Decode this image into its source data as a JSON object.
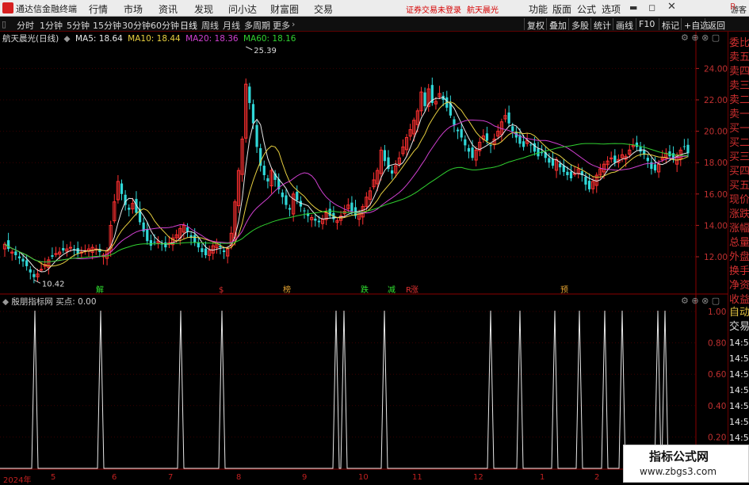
{
  "titlebar": {
    "app_name": "通达信金融终端",
    "menu": [
      "行情",
      "市场",
      "资讯",
      "发现",
      "问小达",
      "财富圈",
      "交易"
    ],
    "login_status": "证券交易未登录",
    "stock_name": "航天晨光",
    "right_menu": [
      "功能",
      "版面",
      "公式",
      "选项"
    ],
    "guest": "游客"
  },
  "toolbar": {
    "periods": [
      "分时",
      "1分钟",
      "5分钟",
      "15分钟",
      "30分钟",
      "60分钟",
      "日线",
      "周线",
      "月线",
      "多周期",
      "更多"
    ],
    "active_period": "日线",
    "right_buttons": [
      "复权",
      "叠加",
      "多股",
      "统计",
      "画线",
      "F10",
      "标记",
      "+自选",
      "返回"
    ]
  },
  "legend": {
    "title": "航天晨光(日线)",
    "ma5": "MA5: 18.64",
    "ma10": "MA10: 18.44",
    "ma20": "MA20: 18.36",
    "ma60": "MA60: 18.16",
    "colors": {
      "ma5": "#e8e8e8",
      "ma10": "#e8d040",
      "ma20": "#d040d0",
      "ma60": "#30d030"
    }
  },
  "annotations": {
    "high": "25.39",
    "low": "10.42",
    "events": [
      {
        "label": "解",
        "color": "#30e030"
      },
      {
        "label": "$",
        "color": "#e03030"
      },
      {
        "label": "榜",
        "color": "#e0a030"
      },
      {
        "label": "跌",
        "color": "#30e030"
      },
      {
        "label": "减",
        "color": "#30e030"
      },
      {
        "label": "R",
        "color": "#e03030"
      },
      {
        "label": "涨",
        "color": "#e03030"
      },
      {
        "label": "预",
        "color": "#e0a030"
      }
    ]
  },
  "indicator": {
    "name": "殷朋指标网",
    "signal": "买点: 0.00",
    "yticks": [
      "1.00",
      "0.80",
      "0.60",
      "0.40",
      "0.20"
    ]
  },
  "chart_data": {
    "type": "candlestick",
    "yticks": [
      "24.00",
      "22.00",
      "20.00",
      "18.00",
      "16.00",
      "14.00",
      "12.00"
    ],
    "ylim": [
      10.4,
      25.4
    ],
    "x_labels": [
      "2024年",
      "5",
      "6",
      "7",
      "8",
      "9",
      "10",
      "11",
      "12",
      "1",
      "2"
    ],
    "close": [
      12.8,
      12.5,
      12.3,
      12.1,
      11.9,
      11.7,
      11.4,
      11.0,
      10.7,
      10.9,
      11.2,
      11.5,
      11.8,
      12.0,
      12.2,
      12.3,
      12.4,
      12.5,
      12.6,
      12.4,
      12.2,
      12.3,
      12.4,
      12.5,
      12.6,
      12.5,
      12.3,
      12.1,
      12.4,
      14.0,
      15.5,
      16.8,
      16.0,
      15.3,
      15.0,
      15.4,
      14.8,
      14.2,
      13.6,
      13.0,
      12.7,
      12.9,
      13.0,
      12.8,
      12.6,
      12.9,
      13.2,
      13.4,
      13.8,
      14.0,
      13.6,
      13.2,
      12.9,
      12.6,
      12.3,
      12.1,
      12.4,
      12.7,
      12.9,
      12.6,
      12.3,
      12.5,
      13.5,
      15.5,
      17.5,
      19.5,
      23.0,
      21.8,
      20.5,
      19.0,
      17.8,
      17.2,
      16.8,
      17.5,
      16.9,
      16.3,
      15.8,
      15.3,
      15.0,
      16.0,
      15.6,
      15.2,
      14.9,
      14.6,
      14.5,
      14.3,
      14.2,
      14.4,
      14.8,
      14.6,
      14.4,
      14.3,
      14.6,
      14.9,
      15.3,
      14.9,
      14.6,
      14.8,
      15.2,
      15.8,
      16.2,
      16.9,
      17.5,
      18.8,
      18.1,
      17.6,
      17.3,
      17.8,
      18.3,
      19.0,
      19.6,
      20.1,
      20.7,
      21.3,
      22.5,
      21.6,
      22.7,
      21.8,
      21.9,
      22.4,
      22.0,
      21.5,
      21.0,
      20.4,
      20.0,
      19.6,
      19.1,
      18.7,
      18.3,
      18.8,
      19.3,
      19.7,
      19.4,
      19.1,
      19.5,
      20.0,
      20.6,
      21.0,
      20.5,
      20.0,
      19.6,
      19.2,
      19.0,
      19.4,
      19.1,
      18.7,
      18.4,
      18.6,
      18.3,
      18.0,
      17.8,
      18.2,
      17.7,
      17.4,
      17.2,
      17.0,
      17.3,
      17.6,
      17.2,
      16.6,
      16.3,
      16.8,
      17.2,
      17.6,
      17.9,
      18.1,
      18.3,
      18.0,
      18.2,
      18.5,
      18.4,
      18.8,
      19.1,
      19.0,
      18.7,
      18.5,
      18.1,
      17.6,
      17.5,
      17.9,
      18.3,
      18.6,
      18.4,
      18.2,
      18.5,
      18.8,
      19.0,
      18.6
    ]
  },
  "watermark": {
    "line1": "指标公式网",
    "line2": "www.zbgs3.com"
  }
}
